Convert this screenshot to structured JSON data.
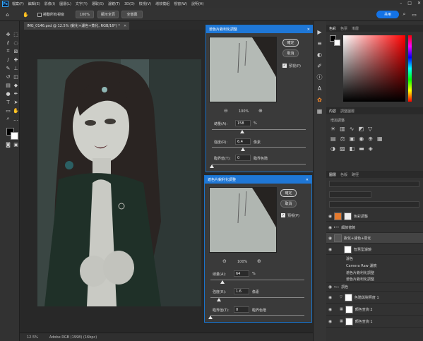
{
  "menubar": {
    "items": [
      "檔案(F)",
      "編輯(E)",
      "影像(I)",
      "圖層(L)",
      "文字(Y)",
      "選取(S)",
      "濾鏡(T)",
      "3D(D)",
      "檢視(V)",
      "增效模組",
      "視窗(W)",
      "說明(H)"
    ],
    "window_controls": [
      "–",
      "□",
      "✕"
    ]
  },
  "options": {
    "scroll_all_label": "捲動所有視窗",
    "zoom_value": "100%",
    "fit_screen_label": "顯示全頁",
    "fill_screen_label": "全螢幕",
    "share_label": "共用"
  },
  "document": {
    "tab_title": "IMG_0146.psd @ 12.5% (銳化+濾色+蒸化, RGB/16*) *",
    "zoom_status": "12.5%",
    "color_profile": "Adobe RGB (1998) (16bpc)"
  },
  "dialog_top": {
    "title": "遮色片銳利化調整",
    "ok_label": "確定",
    "cancel_label": "取消",
    "preview_label": "預視(P)",
    "preview_checked": true,
    "zoom": "100%",
    "amount_label": "總量(A):",
    "amount_value": "158",
    "amount_unit": "%",
    "amount_fraction": 0.32,
    "radius_label": "強度(R):",
    "radius_value": "6.4",
    "radius_unit": "像素",
    "radius_fraction": 0.33,
    "threshold_label": "臨界值(T):",
    "threshold_value": "0",
    "threshold_unit": "臨界色階",
    "threshold_fraction": 0.0
  },
  "dialog_bottom": {
    "title": "遮色片銳利化調整",
    "ok_label": "確定",
    "cancel_label": "取消",
    "preview_label": "預視(P)",
    "preview_checked": true,
    "zoom": "100%",
    "amount_label": "總量(A):",
    "amount_value": "64",
    "amount_unit": "%",
    "amount_fraction": 0.13,
    "radius_label": "強度(R):",
    "radius_value": "1.6",
    "radius_unit": "像素",
    "radius_fraction": 0.09,
    "threshold_label": "臨界值(T):",
    "threshold_value": "0",
    "threshold_unit": "臨界色階",
    "threshold_fraction": 0.0
  },
  "color_panel": {
    "tabs": [
      "色彩",
      "色票",
      "漸層"
    ],
    "accent": "#ff2a2a"
  },
  "props_panel": {
    "tabs": [
      "內容",
      "調整圖層"
    ],
    "heading": "增加調整"
  },
  "layers_panel": {
    "tabs": [
      "圖層",
      "色版",
      "路徑"
    ],
    "rows": [
      {
        "name": "色彩調整",
        "type": "text"
      },
      {
        "name": "細節修飾",
        "type": "group"
      },
      {
        "name": "銳化+濾色+蒸化",
        "type": "smart"
      },
      {
        "name": "智慧型濾鏡",
        "type": "filter"
      },
      {
        "name": "濾色",
        "type": "sub"
      },
      {
        "name": "Camera Raw 濾鏡",
        "type": "sub"
      },
      {
        "name": "遮色片銳利化調整",
        "type": "sub"
      },
      {
        "name": "遮色片銳利化調整",
        "type": "sub"
      },
      {
        "name": "調色",
        "type": "group"
      },
      {
        "name": "色階與對照度 1",
        "type": "adj"
      },
      {
        "name": "顏色查詢 2",
        "type": "adj"
      },
      {
        "name": "顏色查詢 1",
        "type": "adj"
      }
    ]
  }
}
